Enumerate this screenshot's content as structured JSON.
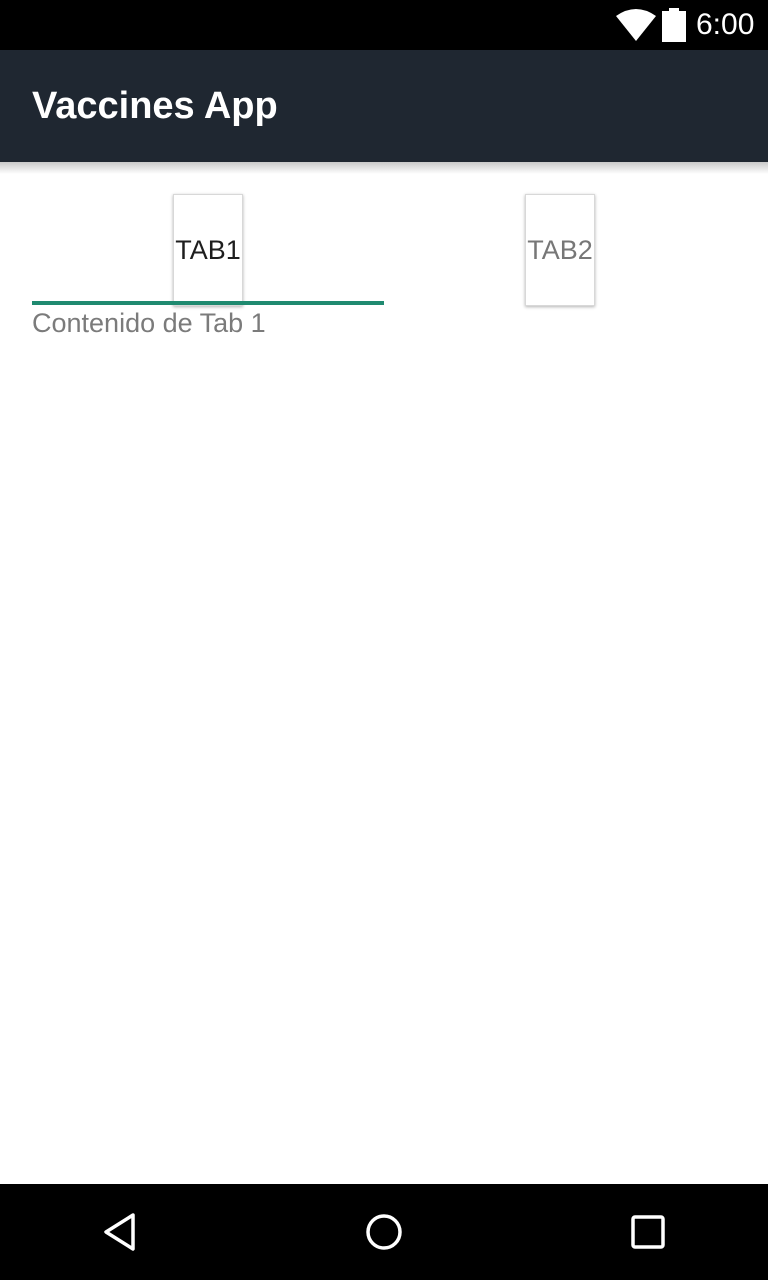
{
  "status_bar": {
    "time": "6:00",
    "icons": [
      "wifi-icon",
      "battery-icon"
    ]
  },
  "app_bar": {
    "title": "Vaccines App",
    "background": "#1f2731"
  },
  "tabs": [
    {
      "label": "TAB1",
      "selected": true
    },
    {
      "label": "TAB2",
      "selected": false
    }
  ],
  "tab_indicator_color": "#1f8a70",
  "content": {
    "text": "Contenido de Tab 1"
  },
  "nav_bar": {
    "buttons": [
      "back-icon",
      "home-icon",
      "recents-icon"
    ]
  }
}
